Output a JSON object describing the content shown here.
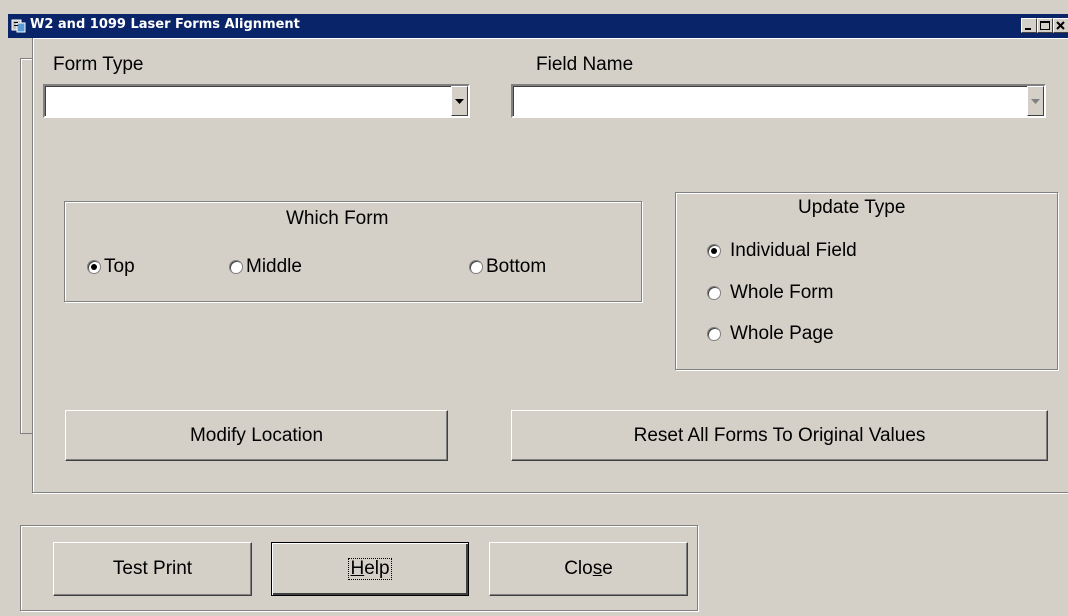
{
  "window": {
    "title": "W2 and 1099 Laser Forms Alignment",
    "controls": [
      "minimize",
      "maximize",
      "close"
    ]
  },
  "form_type": {
    "label": "Form Type",
    "value": ""
  },
  "field_name": {
    "label": "Field Name",
    "value": ""
  },
  "which_form": {
    "title": "Which Form",
    "options": [
      {
        "label": "Top",
        "checked": true
      },
      {
        "label": "Middle",
        "checked": false
      },
      {
        "label": "Bottom",
        "checked": false
      }
    ]
  },
  "update_type": {
    "title": "Update Type",
    "options": [
      {
        "label": "Individual Field",
        "checked": true
      },
      {
        "label": "Whole Form",
        "checked": false
      },
      {
        "label": "Whole Page",
        "checked": false
      }
    ]
  },
  "buttons": {
    "modify_location": "Modify Location",
    "reset_all": "Reset All Forms To Original Values",
    "test_print": "Test Print",
    "help_mnemonic": "H",
    "help_rest": "elp",
    "close_pre": "Clo",
    "close_mnemonic": "s",
    "close_post": "e"
  }
}
